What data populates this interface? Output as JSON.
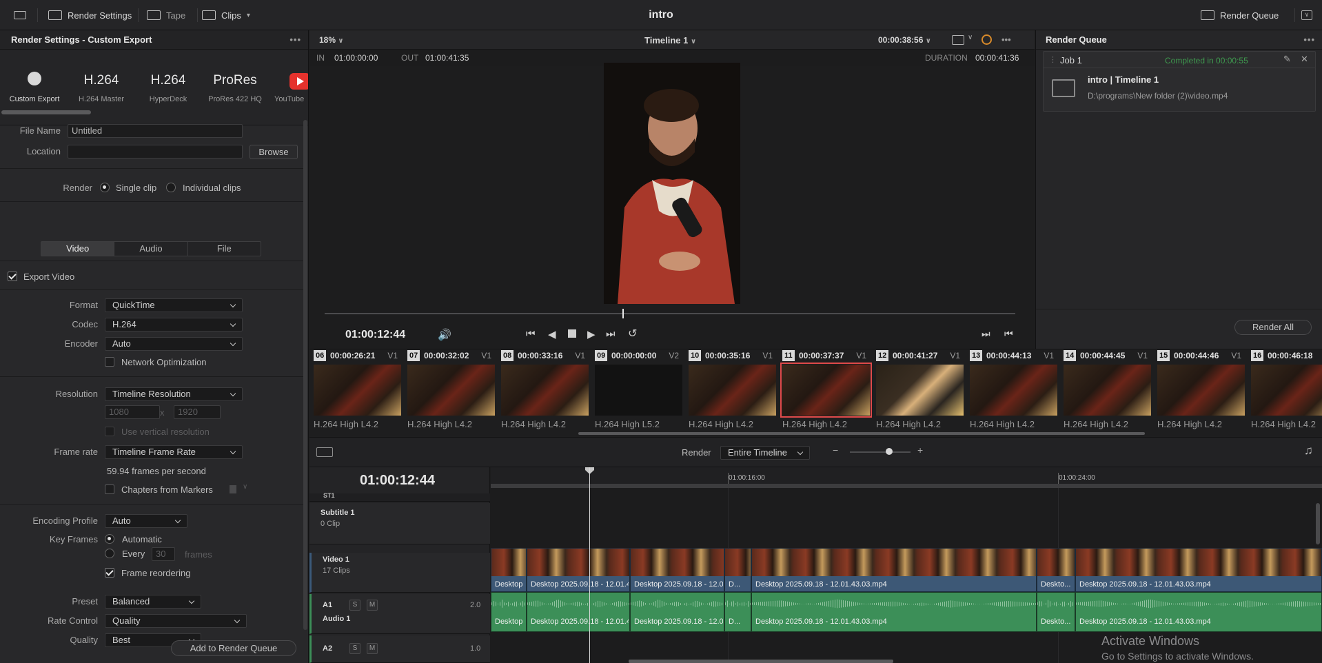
{
  "topbar": {
    "render_settings": "Render Settings",
    "tape": "Tape",
    "clips": "Clips",
    "title": "intro",
    "render_queue": "Render Queue"
  },
  "left": {
    "title": "Render Settings - Custom Export",
    "presets": [
      {
        "big": "",
        "label": "Custom Export"
      },
      {
        "big": "H.264",
        "label": "H.264 Master"
      },
      {
        "big": "H.264",
        "label": "HyperDeck"
      },
      {
        "big": "ProRes",
        "label": "ProRes 422 HQ"
      },
      {
        "big": "",
        "label": "YouTube"
      }
    ],
    "file_name_label": "File Name",
    "file_name_value": "Untitled",
    "location_label": "Location",
    "location_value": "",
    "browse": "Browse",
    "render_label": "Render",
    "single_clip": "Single clip",
    "individual_clips": "Individual clips",
    "tabs": [
      "Video",
      "Audio",
      "File"
    ],
    "export_video": "Export Video",
    "format_label": "Format",
    "format_value": "QuickTime",
    "codec_label": "Codec",
    "codec_value": "H.264",
    "encoder_label": "Encoder",
    "encoder_value": "Auto",
    "network_opt": "Network Optimization",
    "resolution_label": "Resolution",
    "resolution_value": "Timeline Resolution",
    "res_w": "1080",
    "res_x": "x",
    "res_h": "1920",
    "use_vertical": "Use vertical resolution",
    "frame_rate_label": "Frame rate",
    "frame_rate_value": "Timeline Frame Rate",
    "fps_text": "59.94 frames per second",
    "chapters": "Chapters from Markers",
    "encoding_profile_label": "Encoding Profile",
    "encoding_profile_value": "Auto",
    "key_frames_label": "Key Frames",
    "automatic": "Automatic",
    "every": "Every",
    "every_value": "30",
    "frames": "frames",
    "frame_reordering": "Frame reordering",
    "preset_label": "Preset",
    "preset_value": "Balanced",
    "rate_control_label": "Rate Control",
    "rate_control_value": "Quality",
    "quality_label": "Quality",
    "quality_value": "Best",
    "add_to_queue": "Add to Render Queue"
  },
  "viewer": {
    "zoom": "18%",
    "timeline": "Timeline 1",
    "timecode_top": "00:00:38:56",
    "in_label": "IN",
    "in_value": "01:00:00:00",
    "out_label": "OUT",
    "out_value": "01:00:41:35",
    "duration_label": "DURATION",
    "duration_value": "00:00:41:36",
    "current_tc": "01:00:12:44"
  },
  "queue": {
    "title": "Render Queue",
    "job": "Job 1",
    "status": "Completed in 00:00:55",
    "job_title": "intro | Timeline 1",
    "job_path": "D:\\programs\\New folder (2)\\video.mp4",
    "render_all": "Render All"
  },
  "clips": [
    {
      "num": "06",
      "tc": "00:00:26:21",
      "track": "V1",
      "codec": "H.264 High L4.2",
      "kind": "normal"
    },
    {
      "num": "07",
      "tc": "00:00:32:02",
      "track": "V1",
      "codec": "H.264 High L4.2",
      "kind": "normal"
    },
    {
      "num": "08",
      "tc": "00:00:33:16",
      "track": "V1",
      "codec": "H.264 High L4.2",
      "kind": "normal"
    },
    {
      "num": "09",
      "tc": "00:00:00:00",
      "track": "V2",
      "codec": "H.264 High L5.2",
      "kind": "dark"
    },
    {
      "num": "10",
      "tc": "00:00:35:16",
      "track": "V1",
      "codec": "H.264 High L4.2",
      "kind": "normal"
    },
    {
      "num": "11",
      "tc": "00:00:37:37",
      "track": "V1",
      "codec": "H.264 High L4.2",
      "kind": "selected"
    },
    {
      "num": "12",
      "tc": "00:00:41:27",
      "track": "V1",
      "codec": "H.264 High L4.2",
      "kind": "alt"
    },
    {
      "num": "13",
      "tc": "00:00:44:13",
      "track": "V1",
      "codec": "H.264 High L4.2",
      "kind": "normal"
    },
    {
      "num": "14",
      "tc": "00:00:44:45",
      "track": "V1",
      "codec": "H.264 High L4.2",
      "kind": "normal"
    },
    {
      "num": "15",
      "tc": "00:00:44:46",
      "track": "V1",
      "codec": "H.264 High L4.2",
      "kind": "normal"
    },
    {
      "num": "16",
      "tc": "00:00:46:18",
      "track": "",
      "codec": "H.264 High L4.2",
      "kind": "normal"
    }
  ],
  "timeline": {
    "render_label": "Render",
    "render_value": "Entire Timeline",
    "tc": "01:00:12:44",
    "ruler": [
      "01:00:16:00",
      "01:00:24:00"
    ],
    "st1": "ST1",
    "subtitle_name": "Subtitle 1",
    "subtitle_count": "0 Clip",
    "video_name": "Video 1",
    "video_count": "17 Clips",
    "a1": "A1",
    "audio_name": "Audio 1",
    "a1_level": "2.0",
    "a2": "A2",
    "a2_level": "1.0",
    "s": "S",
    "m": "M",
    "video_clips": [
      "Desktop ...",
      "Desktop 2025.09.18 - 12.01.43.0...",
      "Desktop 2025.09.18 - 12.01.4...",
      "D...",
      "Desktop 2025.09.18 - 12.01.43.03.mp4",
      "Deskto...",
      "Desktop 2025.09.18 - 12.01.43.03.mp4"
    ],
    "audio_clips": [
      "Desktop ...",
      "Desktop 2025.09.18 - 12.01.43.0...",
      "Desktop 2025.09.18 - 12.01.4...",
      "D...",
      "Desktop 2025.09.18 - 12.01.43.03.mp4",
      "Deskto...",
      "Desktop 2025.09.18 - 12.01.43.03.mp4"
    ]
  },
  "watermark": {
    "line1": "Activate Windows",
    "line2": "Go to Settings to activate Windows."
  }
}
